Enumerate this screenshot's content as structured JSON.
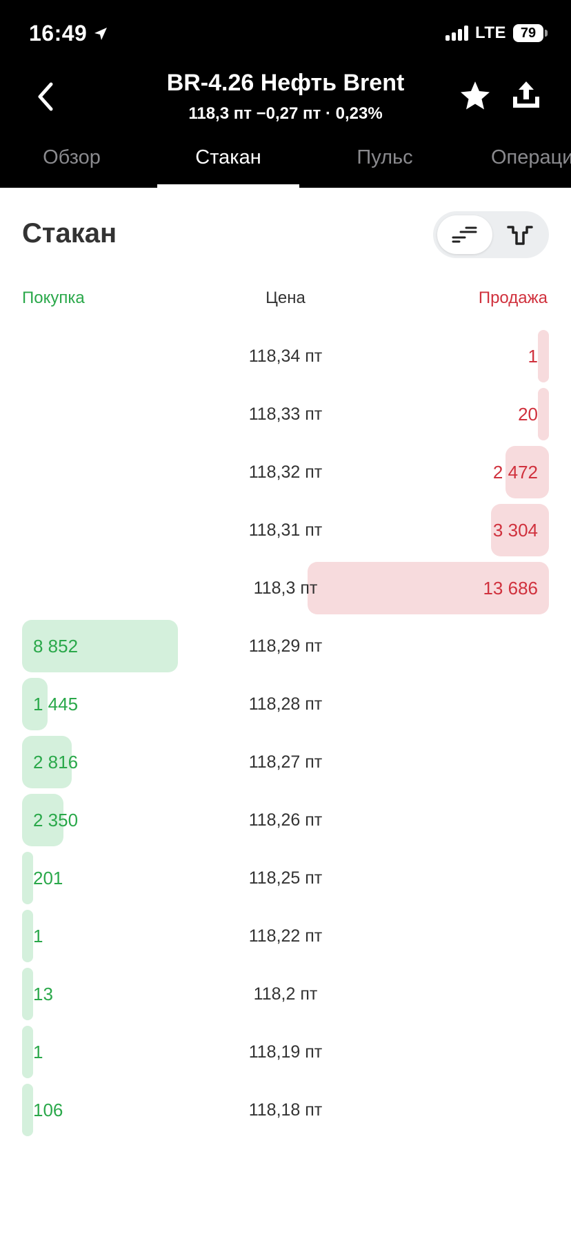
{
  "status_bar": {
    "time": "16:49",
    "network": "LTE",
    "battery": "79"
  },
  "header": {
    "title": "BR-4.26 Нефть Brent",
    "subtitle": "118,3 пт  −0,27 пт · 0,23%"
  },
  "tabs": [
    {
      "label": "Обзор",
      "active": false
    },
    {
      "label": "Стакан",
      "active": true
    },
    {
      "label": "Пульс",
      "active": false
    },
    {
      "label": "Операции",
      "active": false
    }
  ],
  "section": {
    "title": "Стакан"
  },
  "columns": {
    "buy": "Покупка",
    "price": "Цена",
    "sell": "Продажа"
  },
  "colors": {
    "buy": "#2aa84a",
    "sell": "#d0313d",
    "buy_bg": "#d4f0dc",
    "sell_bg": "#f7dbdd"
  },
  "order_book": {
    "asks": [
      {
        "price": "118,34 пт",
        "volume": "1",
        "qty": 1
      },
      {
        "price": "118,33 пт",
        "volume": "20",
        "qty": 20
      },
      {
        "price": "118,32 пт",
        "volume": "2 472",
        "qty": 2472
      },
      {
        "price": "118,31 пт",
        "volume": "3 304",
        "qty": 3304
      },
      {
        "price": "118,3 пт",
        "volume": "13 686",
        "qty": 13686
      }
    ],
    "bids": [
      {
        "price": "118,29 пт",
        "volume": "8 852",
        "qty": 8852
      },
      {
        "price": "118,28 пт",
        "volume": "1 445",
        "qty": 1445
      },
      {
        "price": "118,27 пт",
        "volume": "2 816",
        "qty": 2816
      },
      {
        "price": "118,26 пт",
        "volume": "2 350",
        "qty": 2350
      },
      {
        "price": "118,25 пт",
        "volume": "201",
        "qty": 201
      },
      {
        "price": "118,22 пт",
        "volume": "1",
        "qty": 1
      },
      {
        "price": "118,2 пт",
        "volume": "13",
        "qty": 13
      },
      {
        "price": "118,19 пт",
        "volume": "1",
        "qty": 1
      },
      {
        "price": "118,18 пт",
        "volume": "106",
        "qty": 106
      }
    ]
  }
}
